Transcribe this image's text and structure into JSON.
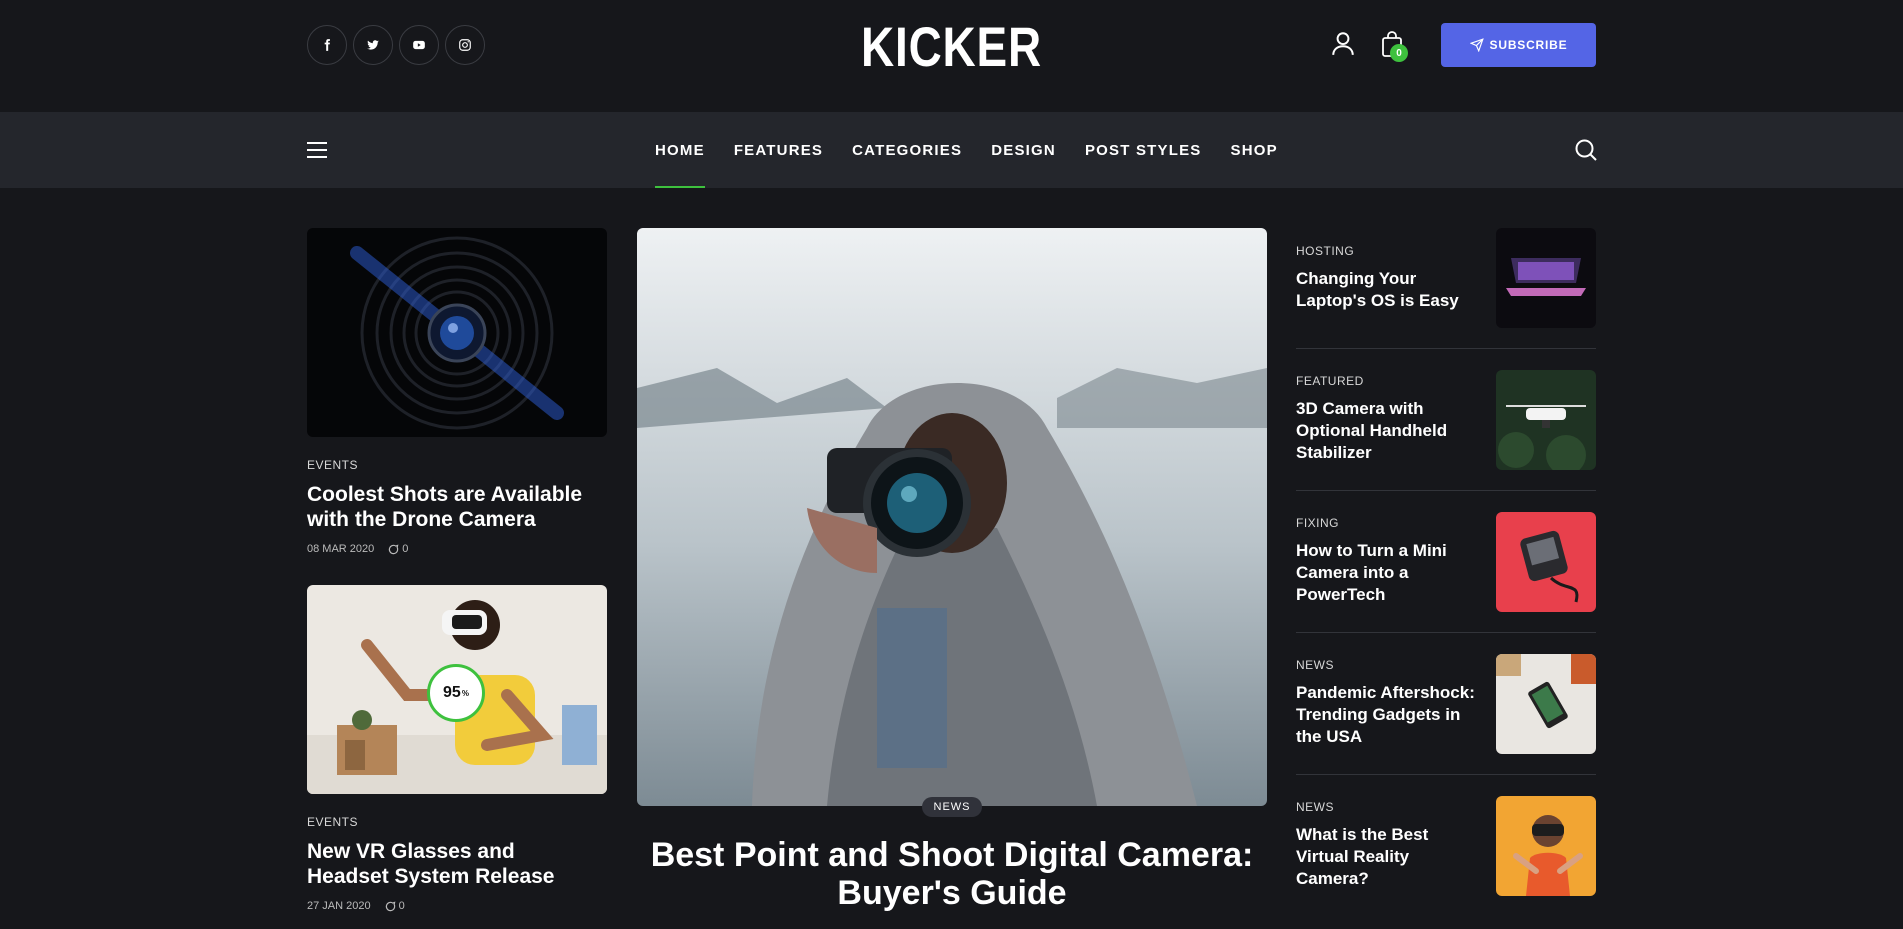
{
  "header": {
    "logo": "KICKER",
    "socials": [
      "facebook-icon",
      "twitter-icon",
      "youtube-icon",
      "instagram-icon"
    ],
    "cart_count": "0",
    "subscribe_label": "SUBSCRIBE"
  },
  "nav": {
    "items": [
      "HOME",
      "FEATURES",
      "CATEGORIES",
      "DESIGN",
      "POST STYLES",
      "SHOP"
    ],
    "active": "HOME"
  },
  "left_posts": [
    {
      "category": "EVENTS",
      "title": "Coolest Shots are Available with the Drone Camera",
      "date": "08 MAR 2020",
      "comments": "0"
    },
    {
      "category": "EVENTS",
      "title": "New VR Glasses and Headset System Release",
      "date": "27 JAN 2020",
      "comments": "0",
      "score": "95",
      "score_unit": "%"
    }
  ],
  "hero": {
    "category": "NEWS",
    "title": "Best Point and Shoot Digital Camera: Buyer's Guide"
  },
  "right_posts": [
    {
      "category": "HOSTING",
      "title": "Changing Your Laptop's OS is Easy"
    },
    {
      "category": "FEATURED",
      "title": "3D Camera with Optional Handheld Stabilizer"
    },
    {
      "category": "FIXING",
      "title": "How to Turn a Mini Camera into a PowerTech"
    },
    {
      "category": "NEWS",
      "title": "Pandemic Aftershock: Trending Gadgets in the USA"
    },
    {
      "category": "NEWS",
      "title": "What is the Best Virtual Reality Camera?"
    }
  ],
  "colors": {
    "background": "#16171b",
    "nav_bg": "#24262c",
    "accent": "#3ec13e",
    "subscribe": "#5465e6"
  }
}
